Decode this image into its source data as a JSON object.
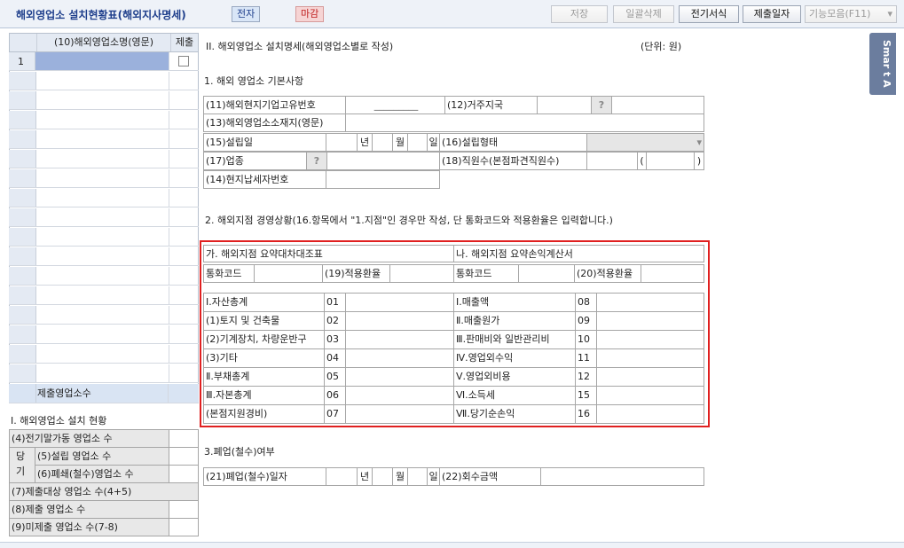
{
  "header": {
    "title": "해외영업소 설치현황표(해외지사명세)",
    "tag_electronic": "전자",
    "tag_deadline": "마감",
    "buttons": [
      "저장",
      "일괄삭제",
      "전기서식",
      "제출일자",
      "기능모음(F11)"
    ]
  },
  "left_grid": {
    "col_name": "(10)해외영업소명(영문)",
    "col_submit": "제출",
    "first_row_no": "1",
    "total_label": "제출영업소수"
  },
  "summary": {
    "section_title": "I. 해외영업소 설치 현황",
    "row4": "(4)전기말가동 영업소 수",
    "dang": "당",
    "gi": "기",
    "row5": "(5)설립 영업소 수",
    "row6": "(6)폐쇄(철수)영업소 수",
    "row7": "(7)제출대상 영업소 수(4+5)",
    "row8": "(8)제출 영업소 수",
    "row9": "(9)미제출 영업소 수(7-8)"
  },
  "main": {
    "section_title": "II. 해외영업소 설치명세(해외영업소별로 작성)",
    "unit": "(단위: 원)",
    "sub1": "1. 해외 영업소 기본사항",
    "f11": "(11)해외현지기업고유번호",
    "f11_value": "_________",
    "f12": "(12)거주지국",
    "f13": "(13)해외영업소소재지(영문)",
    "f15": "(15)설립일",
    "year": "년",
    "month": "월",
    "day": "일",
    "f16": "(16)설립형태",
    "f17": "(17)업종",
    "f18": "(18)직원수(본점파견직원수)",
    "paren_open": "(",
    "paren_close": ")",
    "f14": "(14)현지납세자번호",
    "sub2": "2. 해외지점 경영상황(16.항목에서 \"1.지점\"인 경우만 작성, 단 통화코드와 적용환율은 입력합니다.)",
    "bs_title": "가. 해외지점 요약대차대조표",
    "is_title": "나. 해외지점 요약손익계산서",
    "currency": "통화코드",
    "f19": "(19)적용환율",
    "f20": "(20)적용환율",
    "bs_rows": [
      {
        "label": "Ⅰ.자산총계",
        "code": "01"
      },
      {
        "label": "(1)토지 및 건축물",
        "code": "02"
      },
      {
        "label": "(2)기계장치, 차량운반구",
        "code": "03"
      },
      {
        "label": "(3)기타",
        "code": "04"
      },
      {
        "label": "Ⅱ.부채총계",
        "code": "05"
      },
      {
        "label": "Ⅲ.자본총계",
        "code": "06"
      },
      {
        "label": "(본점지원경비)",
        "code": "07"
      }
    ],
    "is_rows": [
      {
        "label": "Ⅰ.매출액",
        "code": "08"
      },
      {
        "label": "Ⅱ.매출원가",
        "code": "09"
      },
      {
        "label": "Ⅲ.판매비와 일반관리비",
        "code": "10"
      },
      {
        "label": "Ⅳ.영업외수익",
        "code": "11"
      },
      {
        "label": "Ⅴ.영업외비용",
        "code": "12"
      },
      {
        "label": "Ⅵ.소득세",
        "code": "15"
      },
      {
        "label": "Ⅶ.당기순손익",
        "code": "16"
      }
    ],
    "sub3": "3.폐업(철수)여부",
    "f21": "(21)폐업(철수)일자",
    "f22": "(22)회수금액"
  },
  "smart_panel": "Smar t A",
  "colors": {
    "highlight_border": "#e02020",
    "selected_row": "#9bb1dc",
    "header_text": "#1f3f8c"
  }
}
